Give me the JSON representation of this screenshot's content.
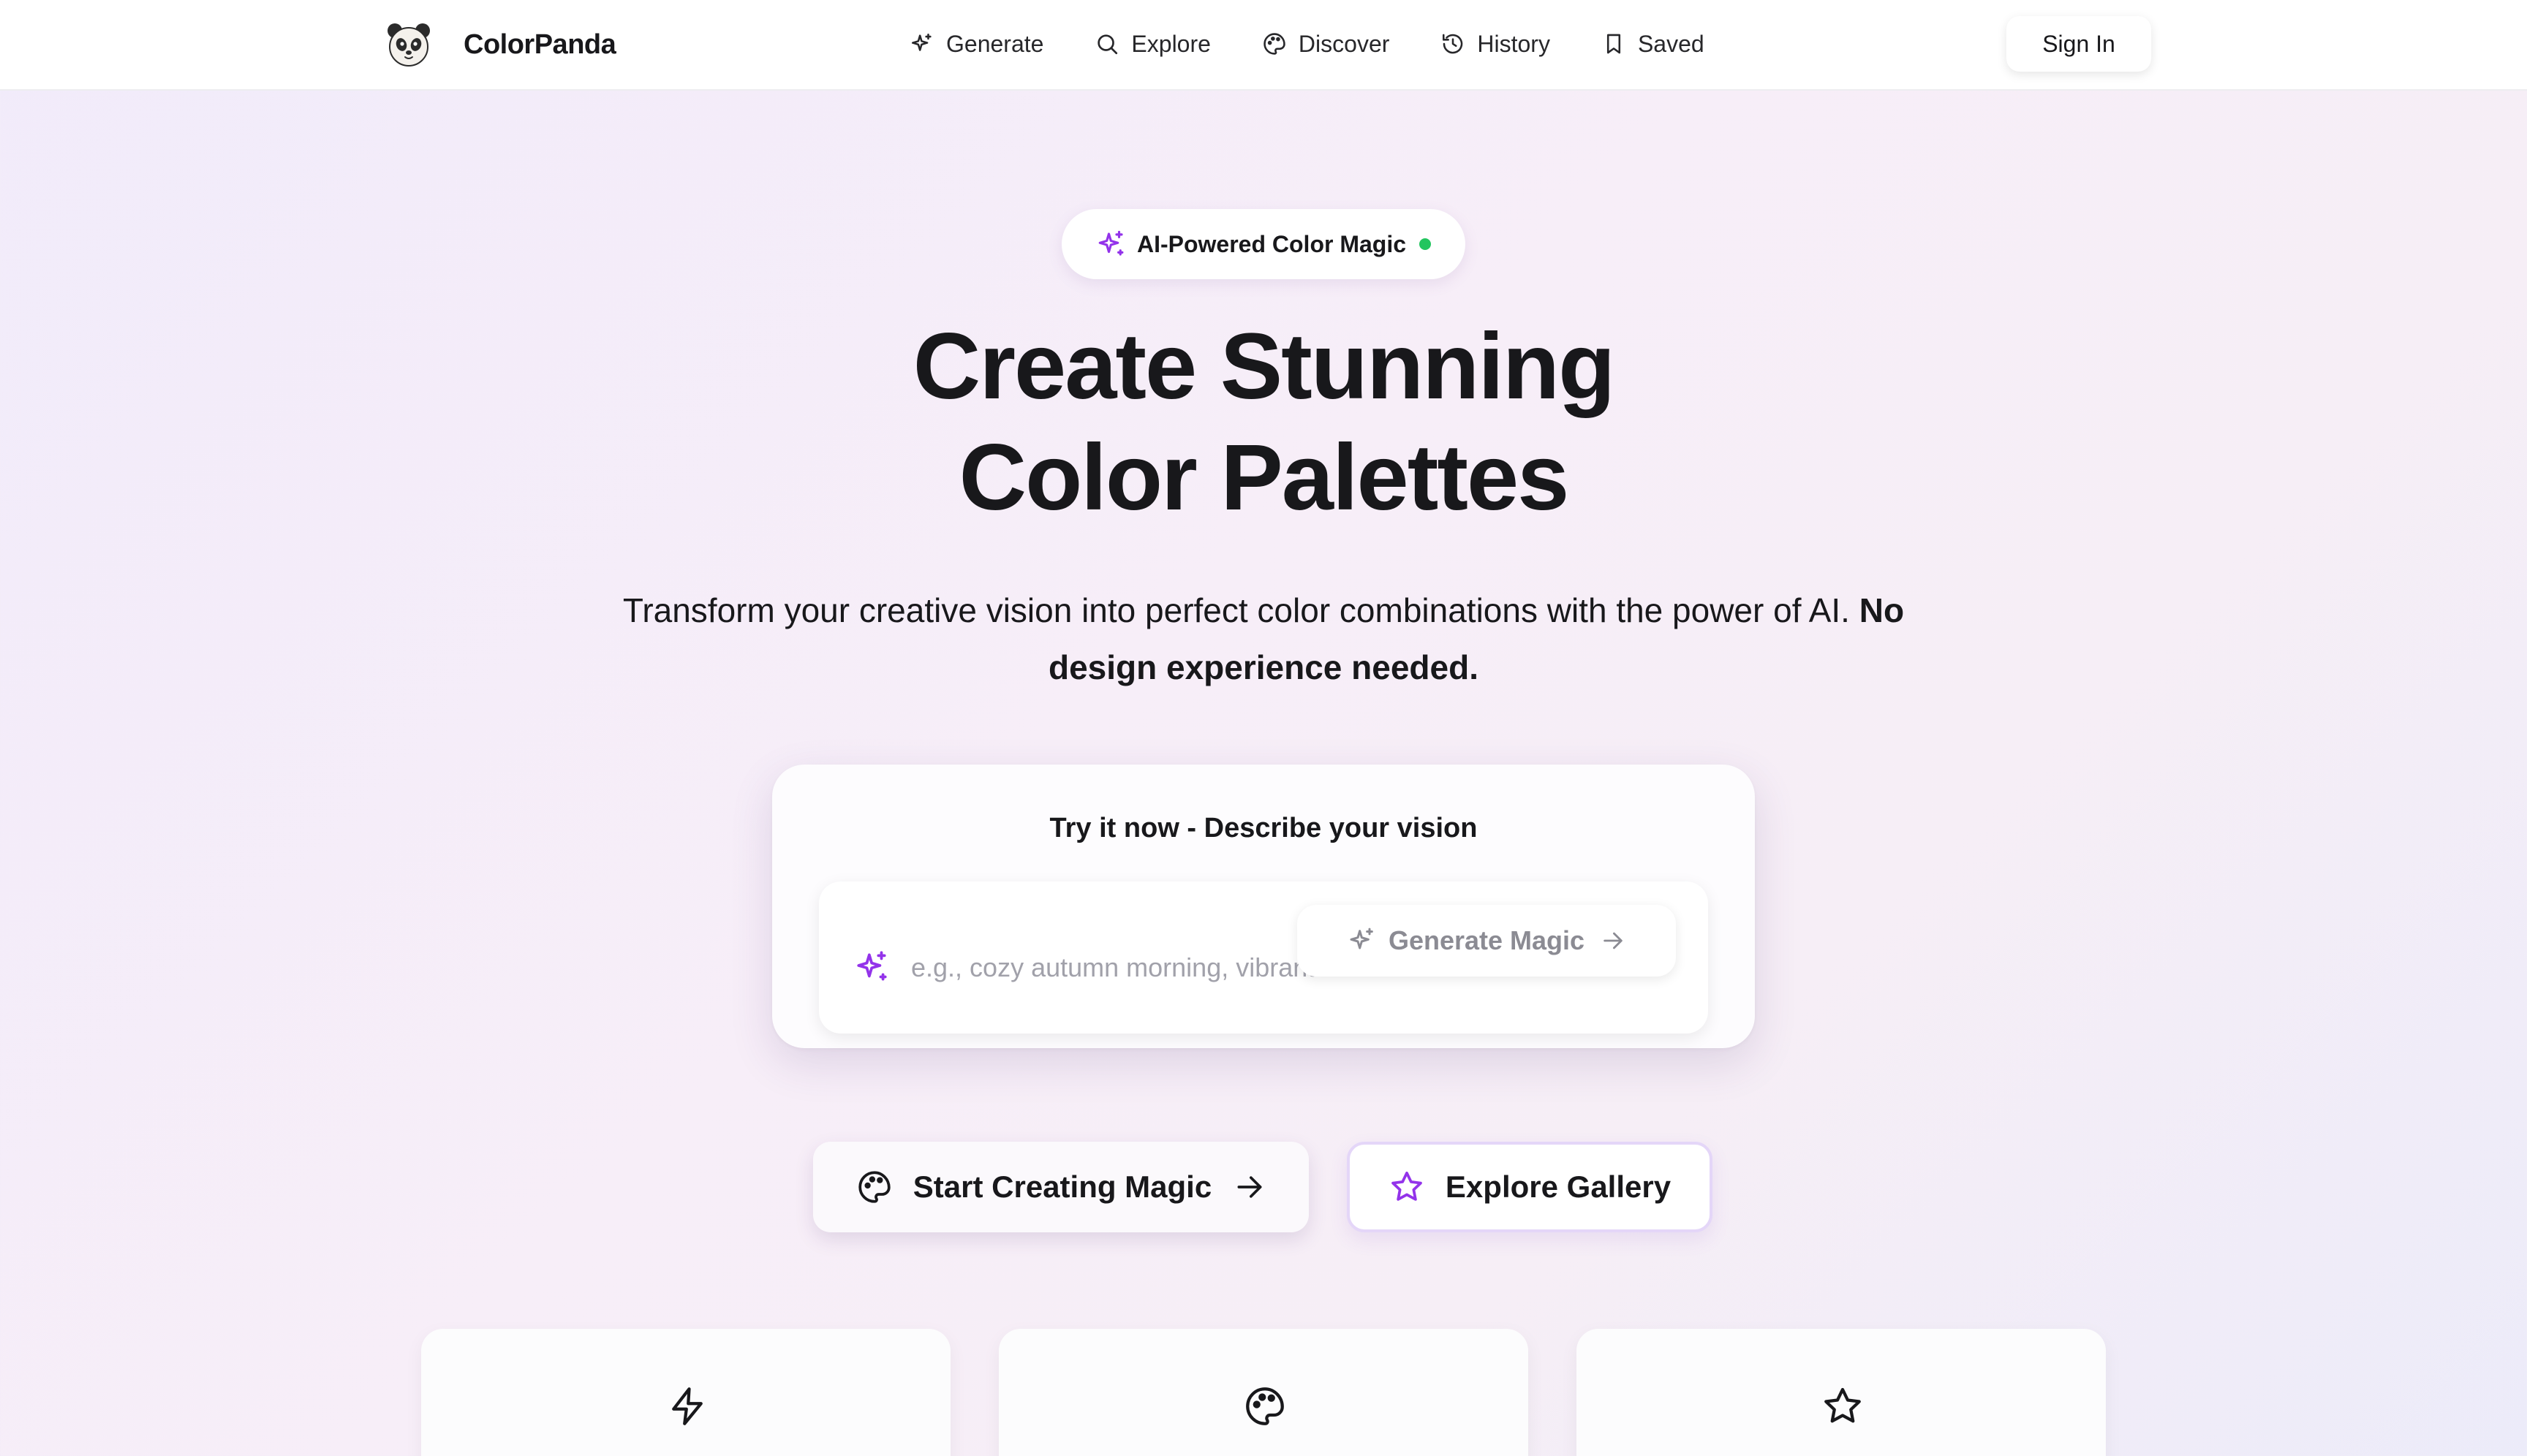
{
  "brand": {
    "name": "ColorPanda",
    "logo_icon": "panda-logo-icon"
  },
  "nav": {
    "items": [
      {
        "label": "Generate",
        "icon": "sparkles-icon"
      },
      {
        "label": "Explore",
        "icon": "search-icon"
      },
      {
        "label": "Discover",
        "icon": "palette-icon"
      },
      {
        "label": "History",
        "icon": "history-icon"
      },
      {
        "label": "Saved",
        "icon": "bookmark-icon"
      }
    ],
    "sign_in_label": "Sign In"
  },
  "hero": {
    "badge": {
      "label": "AI-Powered Color Magic",
      "icon": "sparkles-icon",
      "status_color": "#22c55e"
    },
    "title_line1": "Create Stunning",
    "title_line2": "Color Palettes",
    "subtitle_plain": "Transform your creative vision into perfect color combinations with the power of AI.",
    "subtitle_bold": "No design experience needed."
  },
  "try_card": {
    "title": "Try it now - Describe your vision",
    "input_value": "",
    "input_placeholder": "e.g., cozy autumn morning, vibrant summer sunset",
    "generate_label": "Generate Magic"
  },
  "cta": {
    "start_label": "Start Creating Magic",
    "explore_label": "Explore Gallery"
  },
  "features": [
    {
      "icon": "lightning-icon"
    },
    {
      "icon": "palette-icon"
    },
    {
      "icon": "star-icon"
    }
  ],
  "colors": {
    "accent_purple": "#9333ea",
    "text_dark": "#18181b",
    "muted_text": "#8b8b93",
    "status_green": "#22c55e"
  }
}
